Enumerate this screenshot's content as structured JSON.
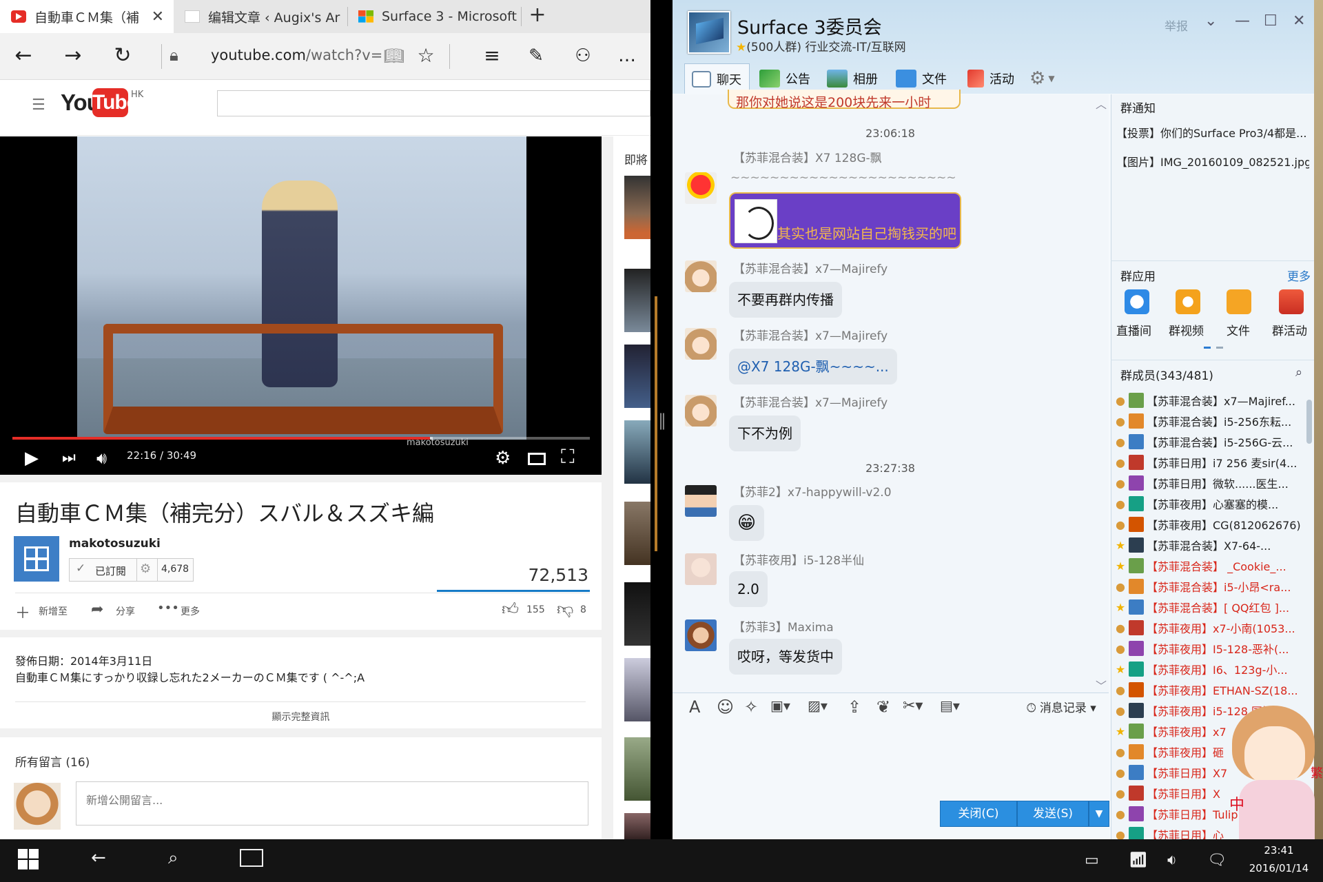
{
  "browser": {
    "tabs": [
      {
        "title": "自動車ＣＭ集（補",
        "icon": "youtube-favicon"
      },
      {
        "title": "编辑文章 ‹ Augix's Ar",
        "icon": "augix-favicon"
      },
      {
        "title": "Surface 3 - Microsoft",
        "icon": "microsoft-favicon"
      }
    ],
    "new_tab": "+",
    "url_host": "youtube.com",
    "url_path": "/watch?v=",
    "nav": {
      "back": "←",
      "forward": "→",
      "refresh": "↻",
      "menu": "…"
    }
  },
  "youtube": {
    "region": "HK",
    "logo_you": "You",
    "logo_tube": "Tube",
    "up_next": "即將",
    "video": {
      "title": "自動車ＣＭ集（補完分）スバル＆スズキ編",
      "time": "22:16 / 30:49",
      "progress": 0.7228,
      "watermark": "makotosuzuki"
    },
    "channel": {
      "name": "makotosuzuki",
      "subscribed_label": "已訂閱",
      "subscriber_count": "4,678"
    },
    "views": "72,513",
    "actions": {
      "add": "新增至",
      "share": "分享",
      "more": "更多",
      "likes": "155",
      "dislikes": "8"
    },
    "description": {
      "date": "發佈日期：2014年3月11日",
      "text": "自動車ＣＭ集にすっかり収録し忘れた2メーカーのＣＭ集です ( ^-^;A",
      "show_more": "顯示完整資訊"
    },
    "comments": {
      "title": "所有留言 (16)",
      "placeholder": "新增公開留言..."
    }
  },
  "qq": {
    "group_name": "Surface 3委员会",
    "group_info": "(500人群) 行业交流-IT/互联网",
    "report": "举报",
    "toolbar": [
      "聊天",
      "公告",
      "相册",
      "文件",
      "活动"
    ],
    "messages": {
      "top_cut": "那你对她说这是200块先来一小时",
      "ts1": "23:06:18",
      "m1_sender": "【苏菲混合装】X7 128G-飘",
      "m1_tildes": "~~~~~~~~~~~~~~~~~~~~~~~",
      "m1_text": "其实也是网站自己掏钱买的吧",
      "m2_sender": "【苏菲混合装】x7—Majirefy",
      "m2_text": "不要再群内传播",
      "m3_sender": "【苏菲混合装】x7—Majirefy",
      "m3_text": "@X7 128G-飘~~~~...",
      "m4_sender": "【苏菲混合装】x7—Majirefy",
      "m4_text": "下不为例",
      "ts2": "23:27:38",
      "m5_sender": "【苏菲2】x7-happywill-v2.0",
      "m5_text": "😁",
      "m6_sender": "【苏菲夜用】i5-128半仙",
      "m6_text": "2.0",
      "m7_sender": "【苏菲3】Maxima",
      "m7_text": "哎呀，等发货中"
    },
    "history": "消息记录",
    "close_btn": "关闭(C)",
    "send_btn": "发送(S)",
    "notice_title": "群通知",
    "notices": [
      "【投票】你们的Surface Pro3/4都是...",
      "【图片】IMG_20160109_082521.jpg"
    ],
    "apps_title": "群应用",
    "apps_more": "更多",
    "apps": [
      "直播间",
      "群视频",
      "文件",
      "群活动"
    ],
    "members_title": "群成员(343/481)",
    "members": [
      "【苏菲混合装】x7—Majiref...",
      "【苏菲混合装】i5-256东耘...",
      "【苏菲混合装】i5-256G-云...",
      "【苏菲日用】i7 256 麦sir(4...",
      "【苏菲日用】微软......医生...",
      "【苏菲夜用】心塞塞的模...",
      "【苏菲夜用】CG(812062676)",
      "【苏菲混合装】X7-64-...",
      "【苏菲混合装】 _Cookie_...",
      "【苏菲混合装】i5-小昂<ra...",
      "【苏菲混合装】[ QQ红包 ]...",
      "【苏菲夜用】x7-小南(1053...",
      "【苏菲夜用】I5-128-恶补(...",
      "【苏菲夜用】I6、123g-小...",
      "【苏菲夜用】ETHAN-SZ(18...",
      "【苏菲夜用】i5-128 同比",
      "【苏菲夜用】x7",
      "【苏菲夜用】砸",
      "【苏菲日用】X7",
      "【苏菲日用】X",
      "【苏菲日用】Tulip",
      "【苏菲日用】心"
    ],
    "mascot_text": "中",
    "mascot_text2": "繁"
  },
  "taskbar": {
    "time": "23:41",
    "date": "2016/01/14"
  }
}
